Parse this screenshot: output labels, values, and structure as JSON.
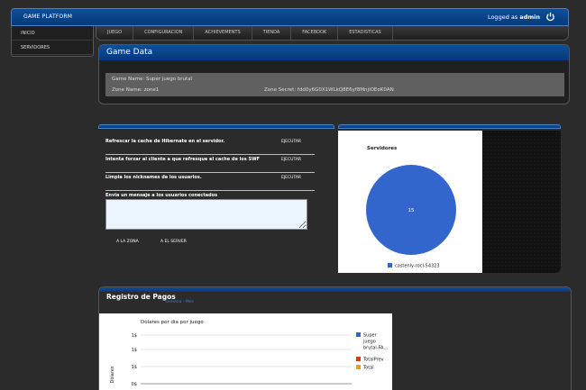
{
  "header": {
    "brand": "GAME PLATFORM",
    "logged_prefix": "Logged as",
    "user": "admin"
  },
  "sidebar": {
    "items": [
      {
        "label": "INICIO"
      },
      {
        "label": "SERVIDORES"
      }
    ]
  },
  "tabs": [
    {
      "label": "JUEGO"
    },
    {
      "label": "CONFIGURACION"
    },
    {
      "label": "ACHIEVEMENTS"
    },
    {
      "label": "TIENDA"
    },
    {
      "label": "FACEBOOK"
    },
    {
      "label": "ESTADISTICAS"
    }
  ],
  "game_data": {
    "title": "Game Data",
    "game_name": "Game Name: Super juego brutal",
    "zone_name": "Zone Name: zone1",
    "zone_secret": "Zone Secret: fdd0y6G0X1WLkQ8E6yf8MnjlOEoK0AN"
  },
  "actions": {
    "rows": [
      {
        "label": "Refrescar la cache de Hibernate en el servidor.",
        "button": "EJECUTAR"
      },
      {
        "label": "Intenta forzar al cliente a que refresque el cache de los SWF",
        "button": "EJECUTAR"
      },
      {
        "label": "Limpia los nicknames de los usuarios.",
        "button": "EJECUTAR"
      }
    ],
    "message_label": "Envia un mensaje a los usuarios conectados",
    "send_zone": "A LA ZONA",
    "send_server": "A EL SERVER"
  },
  "payments": {
    "title": "Registro de Pagos",
    "links": "Semana - Mes"
  },
  "colors": {
    "accent": "#0d4f99",
    "pie": "#3366cc",
    "series": [
      "#3366cc",
      "#dc3912",
      "#ff9900"
    ]
  },
  "chart_data": [
    {
      "type": "pie",
      "title": "Servidores",
      "labels": [
        "castenly-rocl-54323"
      ],
      "values": [
        15
      ],
      "legend": "bottom"
    },
    {
      "type": "line",
      "title": "Dólares por dia por juego",
      "ylabel": "Dólares",
      "y_ticks": [
        "1$",
        "1$",
        "1$",
        "0$"
      ],
      "series": [
        {
          "name": "Super juego brutal-FA..."
        },
        {
          "name": "TotalPrev"
        },
        {
          "name": "Total"
        }
      ],
      "legend": "right"
    }
  ]
}
